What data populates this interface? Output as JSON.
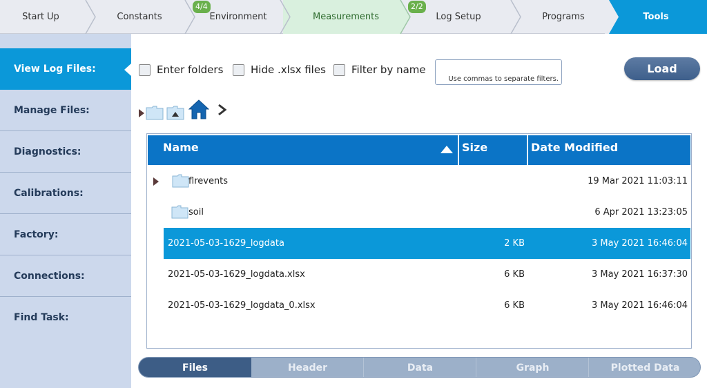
{
  "wizard": {
    "steps": [
      {
        "label": "Start Up"
      },
      {
        "label": "Constants"
      },
      {
        "label": "Environment",
        "badge": "4/4"
      },
      {
        "label": "Measurements"
      },
      {
        "label": "Log Setup",
        "badge": "2/2"
      },
      {
        "label": "Programs"
      },
      {
        "label": "Tools"
      }
    ],
    "active_step_color": "#0b98d9",
    "highlight_step_color": "#d9f0de",
    "badge_color": "#6ab04c"
  },
  "sidebar": {
    "items": [
      {
        "label": "View Log Files:"
      },
      {
        "label": "Manage Files:"
      },
      {
        "label": "Diagnostics:"
      },
      {
        "label": "Calibrations:"
      },
      {
        "label": "Factory:"
      },
      {
        "label": "Connections:"
      },
      {
        "label": "Find Task:"
      }
    ]
  },
  "filters": {
    "enter_folders": "Enter folders",
    "hide_xlsx": "Hide .xlsx files",
    "filter_by_name": "Filter by name",
    "filter_hint": "Use commas to separate filters.",
    "load_label": "Load"
  },
  "path_toolbar": {
    "icons": [
      "expand-triangle-icon",
      "folder-icon",
      "folder-up-icon",
      "home-icon",
      "chevron-right-icon"
    ]
  },
  "table": {
    "columns": {
      "name": "Name",
      "size": "Size",
      "date": "Date Modified"
    },
    "sort": "name-ascending",
    "rows": [
      {
        "name": "flrevents",
        "size": "",
        "date": "19 Mar 2021 11:03:11",
        "type": "folder",
        "expandable": true
      },
      {
        "name": "soil",
        "size": "",
        "date": "6 Apr 2021 13:23:05",
        "type": "folder",
        "expandable": false
      },
      {
        "name": "2021-05-03-1629_logdata",
        "size": "2 KB",
        "date": "3 May 2021 16:46:04",
        "type": "file",
        "selected": true
      },
      {
        "name": "2021-05-03-1629_logdata.xlsx",
        "size": "6 KB",
        "date": "3 May 2021 16:37:30",
        "type": "file"
      },
      {
        "name": "2021-05-03-1629_logdata_0.xlsx",
        "size": "6 KB",
        "date": "3 May 2021 16:46:04",
        "type": "file"
      }
    ]
  },
  "tabs": [
    {
      "label": "Files"
    },
    {
      "label": "Header"
    },
    {
      "label": "Data"
    },
    {
      "label": "Graph"
    },
    {
      "label": "Plotted Data"
    }
  ]
}
